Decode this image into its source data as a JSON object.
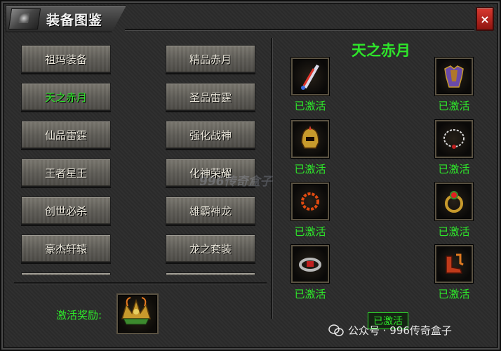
{
  "window": {
    "title": "装备图鉴",
    "close_label": "×"
  },
  "sets": [
    {
      "label": "祖玛装备",
      "active": false
    },
    {
      "label": "精品赤月",
      "active": false
    },
    {
      "label": "天之赤月",
      "active": true
    },
    {
      "label": "圣品雷霆",
      "active": false
    },
    {
      "label": "仙品雷霆",
      "active": false
    },
    {
      "label": "强化战神",
      "active": false
    },
    {
      "label": "王者星王",
      "active": false
    },
    {
      "label": "化神荣耀",
      "active": false
    },
    {
      "label": "创世必杀",
      "active": false
    },
    {
      "label": "雄霸神龙",
      "active": false
    },
    {
      "label": "豪杰轩辕",
      "active": false
    },
    {
      "label": "龙之套装",
      "active": false
    }
  ],
  "detail": {
    "title": "天之赤月",
    "items": [
      {
        "icon": "weapon-icon",
        "status": "已激活"
      },
      {
        "icon": "armor-icon",
        "status": "已激活"
      },
      {
        "icon": "helmet-icon",
        "status": "已激活"
      },
      {
        "icon": "necklace-icon",
        "status": "已激活"
      },
      {
        "icon": "bracelet-icon",
        "status": "已激活"
      },
      {
        "icon": "ring-icon",
        "status": "已激活"
      },
      {
        "icon": "belt-icon",
        "status": "已激活"
      },
      {
        "icon": "boots-icon",
        "status": "已激活"
      }
    ],
    "reward_label": "激活奖励:",
    "reward_icon": "crown-icon",
    "reward_status": "已激活"
  },
  "watermark": "996传奇盒子",
  "footer": {
    "credit": "公众号 · 996传奇盒子"
  },
  "colors": {
    "accent_green": "#2ee62a",
    "close_red": "#c0281f"
  }
}
